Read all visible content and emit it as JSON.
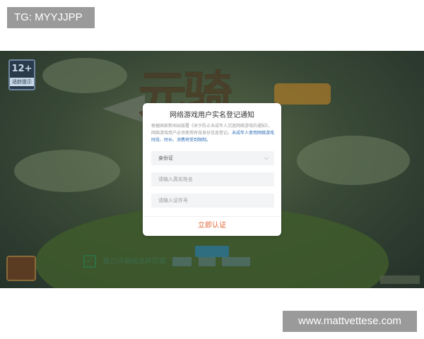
{
  "watermark_top": "TG: MYYJJPP",
  "watermark_bottom": "www.mattvettese.com",
  "game": {
    "age_rating": "12+",
    "age_rating_sub": "适龄提示",
    "start_button": "",
    "agree_text": "我已详细阅读并同意",
    "agree_links": [
      "",
      "",
      ""
    ],
    "footer_text": ""
  },
  "dialog": {
    "title": "网络游戏用户实名登记通知",
    "body_line1": "根据国家新闻出版署《关于防止未成年人沉迷网络游戏的通知》，网络游戏用户必须使用有效身份信息登记。",
    "body_highlight": "未成年人使用网络游戏时段、时长、消费将受到限制。",
    "id_type": "身份证",
    "name_placeholder": "请输入真实姓名",
    "id_placeholder": "请输入证件号",
    "submit_label": "立即认证"
  }
}
